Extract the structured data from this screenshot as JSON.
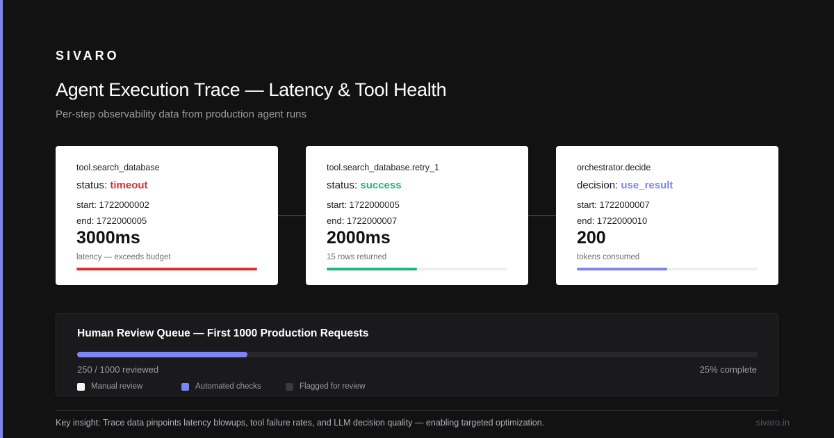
{
  "brand": "SIVARO",
  "title": "Agent Execution Trace — Latency & Tool Health",
  "subtitle": "Per-step observability data from production agent runs",
  "colors": {
    "accent": "#7c85f2",
    "timeout": "#d93030",
    "success": "#1db87a",
    "decision": "#7c85f2"
  },
  "cards": [
    {
      "name": "tool.search_database",
      "status_label": "status:",
      "status_value": "timeout",
      "start": "start: 1722000002",
      "end": "end: 1722000005",
      "metric": "3000ms",
      "caption": "latency — exceeds budget",
      "progress": 1.0
    },
    {
      "name": "tool.search_database.retry_1",
      "status_label": "status:",
      "status_value": "success",
      "start": "start: 1722000005",
      "end": "end: 1722000007",
      "metric": "2000ms",
      "caption": "15 rows returned",
      "progress": 0.5
    },
    {
      "name": "orchestrator.decide",
      "status_label": "decision:",
      "status_value": "use_result",
      "start": "start: 1722000007",
      "end": "end: 1722000010",
      "metric": "200",
      "caption": "tokens consumed",
      "progress": 0.5
    }
  ],
  "queue": {
    "title": "Human Review Queue — First 1000 Production Requests",
    "count_text": "250 / 1000 reviewed",
    "percent_text": "25% complete",
    "progress": 0.25,
    "legend": [
      {
        "label": "Manual review",
        "color": "#f5f5f5"
      },
      {
        "label": "Automated checks",
        "color": "#7c85f2"
      },
      {
        "label": "Flagged for review",
        "color": "#3a3a3e"
      }
    ]
  },
  "footer": {
    "insight": "Key insight: Trace data pinpoints latency blowups, tool failure rates, and LLM decision quality — enabling targeted optimization.",
    "site": "sivaro.in"
  }
}
